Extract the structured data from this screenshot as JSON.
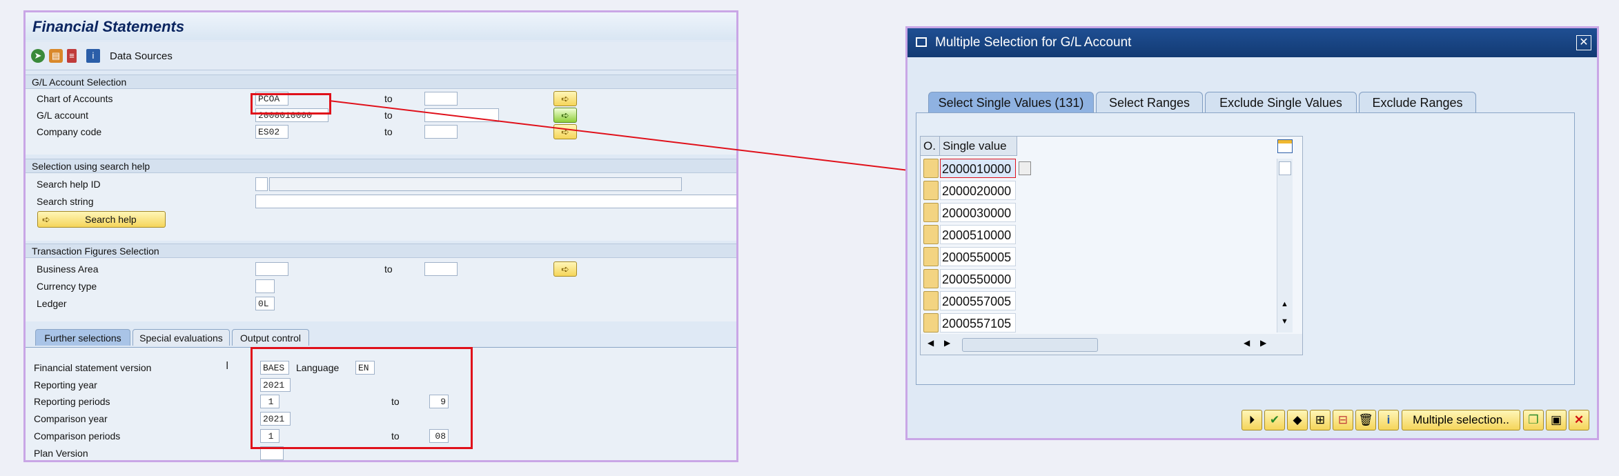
{
  "left": {
    "title": "Financial Statements",
    "toolbar": {
      "data_sources": "Data Sources"
    },
    "gl_group": {
      "title": "G/L Account Selection",
      "chart_of_accounts": {
        "label": "Chart of Accounts",
        "value": "PCOA",
        "to": "to"
      },
      "gl_account": {
        "label": "G/L account",
        "value": "2000010000",
        "to": "to"
      },
      "company_code": {
        "label": "Company code",
        "value": "ES02",
        "to": "to"
      }
    },
    "search_group": {
      "title": "Selection using search help",
      "search_help_id": "Search help ID",
      "search_string": "Search string",
      "button": "Search help"
    },
    "tf_group": {
      "title": "Transaction Figures Selection",
      "business_area": {
        "label": "Business Area",
        "to": "to"
      },
      "currency_type": "Currency type",
      "ledger": {
        "label": "Ledger",
        "value": "0L"
      }
    },
    "tabs": [
      "Further selections",
      "Special evaluations",
      "Output control"
    ],
    "further": {
      "fs_version": {
        "label": "Financial statement version",
        "value": "BAES",
        "language_label": "Language",
        "language": "EN"
      },
      "reporting_year": {
        "label": "Reporting year",
        "value": "2021"
      },
      "reporting_periods": {
        "label": "Reporting periods",
        "from": "1",
        "to_label": "to",
        "to": "9"
      },
      "comparison_year": {
        "label": "Comparison year",
        "value": "2021"
      },
      "comparison_periods": {
        "label": "Comparison periods",
        "from": "1",
        "to_label": "to",
        "to": "08"
      },
      "plan_version": {
        "label": "Plan Version"
      }
    }
  },
  "dialog": {
    "title": "Multiple Selection for G/L Account",
    "close": "✕",
    "tabs": [
      "Select Single Values (131)",
      "Select Ranges",
      "Exclude Single Values",
      "Exclude Ranges"
    ],
    "grid": {
      "col_o": "O.",
      "col_value": "Single value",
      "values": [
        "2000010000",
        "2000020000",
        "2000030000",
        "2000510000",
        "2000550005",
        "2000550000",
        "2000557005",
        "2000557105"
      ]
    },
    "footer": {
      "multiple_selection": "Multiple selection.."
    }
  },
  "colors": {
    "highlight": "#e0101a",
    "sap_title": "#1f4f93",
    "button_yellow": "#f5d55a",
    "frame": "#c9a6e6"
  }
}
